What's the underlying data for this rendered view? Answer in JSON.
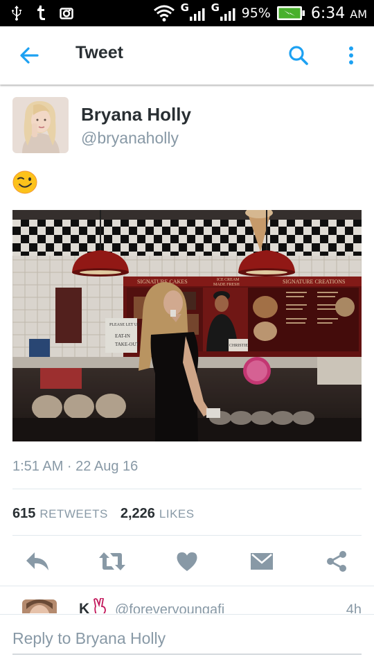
{
  "status_bar": {
    "network_1": "G",
    "network_2": "G",
    "battery_percent": "95%",
    "time": "6:34",
    "time_suffix": "AM",
    "icons": [
      "usb-icon",
      "tumblr-icon",
      "camera-icon",
      "wifi-icon",
      "signal-icon",
      "battery-charging-icon"
    ]
  },
  "appbar": {
    "title": "Tweet",
    "icons": [
      "back-arrow-icon",
      "search-icon",
      "more-vertical-icon"
    ]
  },
  "tweet": {
    "author_name": "Bryana Holly",
    "author_handle": "@bryanaholly",
    "emoji": "winking-face-emoji",
    "timestamp": "1:51 AM · 22 Aug 16",
    "retweets_count": "615",
    "retweets_label": "RETWEETS",
    "likes_count": "2,226",
    "likes_label": "LIKES",
    "photo_signs": [
      "SIGNATURE CAKES",
      "ICE CREAM MADE FRESH",
      "SIGNATURE CREATIONS"
    ]
  },
  "actions": [
    "reply-icon",
    "retweet-icon",
    "like-heart-icon",
    "direct-message-icon",
    "share-icon"
  ],
  "reply_preview": {
    "name": "K",
    "handle": "@foreveryoungafi",
    "time": "4h"
  },
  "reply_box": {
    "placeholder": "Reply to Bryana Holly"
  },
  "colors": {
    "accent": "#1da1f2",
    "icon_gray": "#8899a6",
    "text_dark": "#292f33"
  }
}
